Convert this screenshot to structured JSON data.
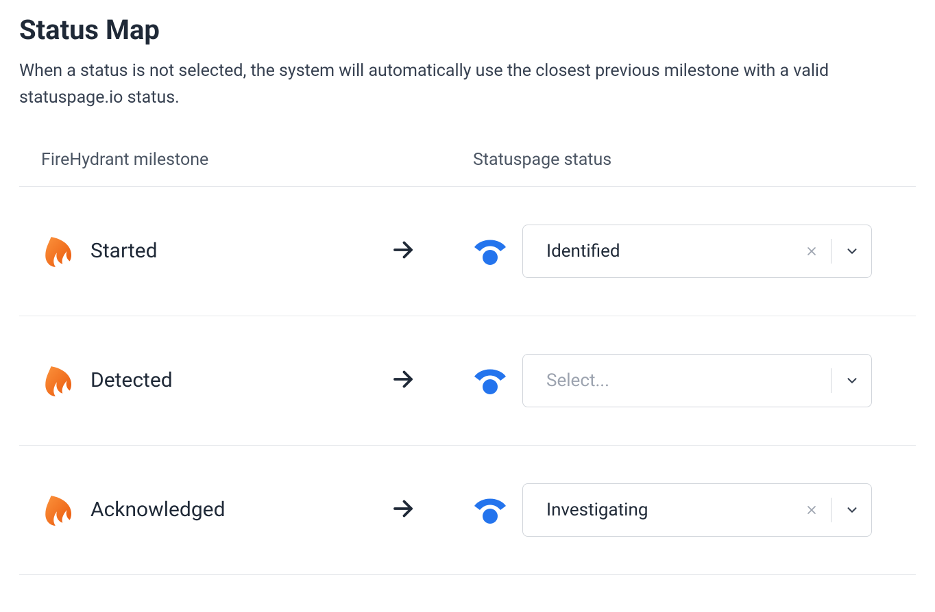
{
  "header": {
    "title": "Status Map",
    "description": "When a status is not selected, the system will automatically use the closest previous milestone with a valid statuspage.io status."
  },
  "columns": {
    "left": "FireHydrant milestone",
    "right": "Statuspage status"
  },
  "select_placeholder": "Select...",
  "rows": [
    {
      "milestone": "Started",
      "status": "Identified",
      "has_value": true
    },
    {
      "milestone": "Detected",
      "status": "",
      "has_value": false
    },
    {
      "milestone": "Acknowledged",
      "status": "Investigating",
      "has_value": true
    }
  ]
}
